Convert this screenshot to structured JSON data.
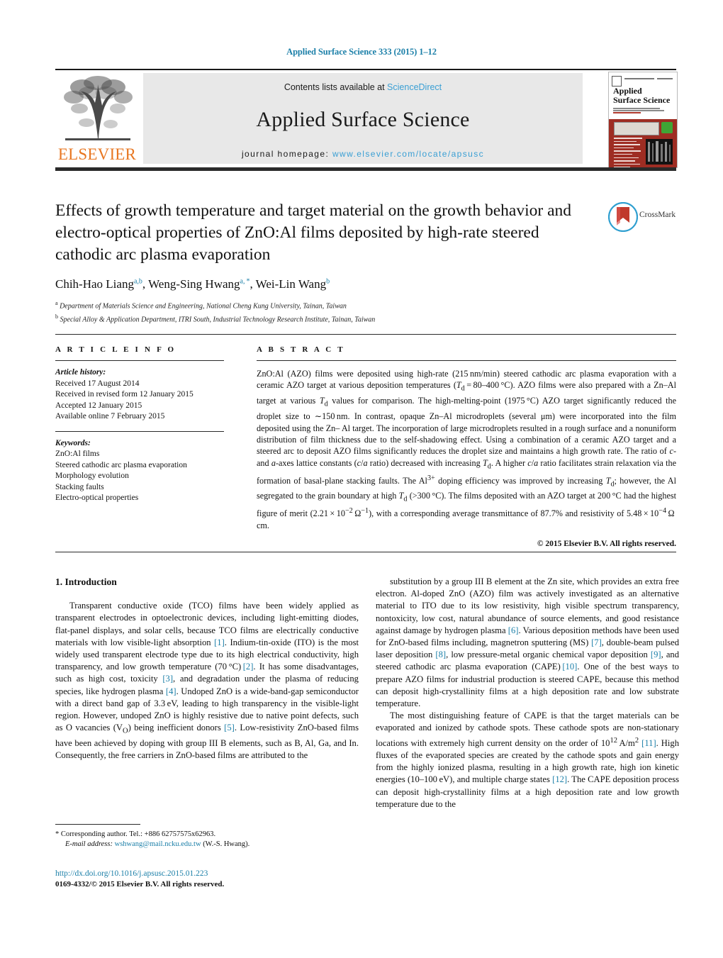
{
  "running_head": "Applied Surface Science 333 (2015) 1–12",
  "masthead": {
    "publisher_wordmark": "ELSEVIER",
    "contents_prefix": "Contents lists available at ",
    "contents_link": "ScienceDirect",
    "journal_title": "Applied Surface Science",
    "homepage_prefix": "journal homepage: ",
    "homepage_link": "www.elsevier.com/locate/apsusc",
    "cover": {
      "title_line1": "Applied",
      "title_line2": "Surface Science"
    },
    "link_color": "#3a9fd4",
    "wordmark_color": "#e87722"
  },
  "article": {
    "title": "Effects of growth temperature and target material on the growth behavior and electro-optical properties of ZnO:Al films deposited by high-rate steered cathodic arc plasma evaporation",
    "authors_html": "Chih-Hao Liang<sup>a,b</sup>, Weng-Sing Hwang<sup>a, *</sup>, Wei-Lin Wang<sup>b</sup>",
    "affiliations": [
      "Department of Materials Science and Engineering, National Cheng Kung University, Tainan, Taiwan",
      "Special Alloy & Application Department, ITRI South, Industrial Technology Research Institute, Tainan, Taiwan"
    ],
    "crossmark_label": "CrossMark"
  },
  "info": {
    "heading": "A R T I C L E   I N F O",
    "history_label": "Article history:",
    "history": [
      "Received 17 August 2014",
      "Received in revised form 12 January 2015",
      "Accepted 12 January 2015",
      "Available online 7 February 2015"
    ],
    "keywords_label": "Keywords:",
    "keywords": [
      "ZnO:Al films",
      "Steered cathodic arc plasma evaporation",
      "Morphology evolution",
      "Stacking faults",
      "Electro-optical properties"
    ]
  },
  "abstract": {
    "heading": "A B S T R A C T",
    "text_html": "ZnO:Al (AZO) films were deposited using high-rate (215 nm/min) steered cathodic arc plasma evaporation with a ceramic AZO target at various deposition temperatures (<i>T</i><sub>d</sub> = 80–400 °C). AZO films were also prepared with a Zn–Al target at various <i>T</i><sub>d</sub> values for comparison. The high-melting-point (1975 °C) AZO target significantly reduced the droplet size to ∼150 nm. In contrast, opaque Zn–Al microdroplets (several μm) were incorporated into the film deposited using the Zn– Al target. The incorporation of large microdroplets resulted in a rough surface and a nonuniform distribution of film thickness due to the self-shadowing effect. Using a combination of a ceramic AZO target and a steered arc to deposit AZO films significantly reduces the droplet size and maintains a high growth rate. The ratio of <i>c</i>- and <i>a</i>-axes lattice constants (<i>c</i>/<i>a</i> ratio) decreased with increasing <i>T</i><sub>d</sub>. A higher <i>c</i>/<i>a</i> ratio facilitates strain relaxation via the formation of basal-plane stacking faults. The Al<sup>3+</sup> doping efficiency was improved by increasing <i>T</i><sub>d</sub>; however, the Al segregated to the grain boundary at high <i>T</i><sub>d</sub> (>300 °C). The films deposited with an AZO target at 200 °C had the highest figure of merit (2.21 × 10<sup>−2</sup> Ω<sup>−1</sup>), with a corresponding average transmittance of 87.7% and resistivity of 5.48 × 10<sup>−4</sup> Ω cm.",
    "copyright": "© 2015 Elsevier B.V. All rights reserved."
  },
  "body": {
    "section_heading": "1.  Introduction",
    "left_paragraphs_html": [
      "Transparent conductive oxide (TCO) films have been widely applied as transparent electrodes in optoelectronic devices, including light-emitting diodes, flat-panel displays, and solar cells, because TCO films are electrically conductive materials with low visible-light absorption <span class=\"ref\">[1]</span>. Indium-tin-oxide (ITO) is the most widely used transparent electrode type due to its high electrical conductivity, high transparency, and low growth temperature (70 °C) <span class=\"ref\">[2]</span>. It has some disadvantages, such as high cost, toxicity <span class=\"ref\">[3]</span>, and degradation under the plasma of reducing species, like hydrogen plasma <span class=\"ref\">[4]</span>. Undoped ZnO is a wide-band-gap semiconductor with a direct band gap of 3.3 eV, leading to high transparency in the visible-light region. However, undoped ZnO is highly resistive due to native point defects, such as O vacancies (V<sub>O</sub>) being inefficient donors <span class=\"ref\">[5]</span>. Low-resistivity ZnO-based films have been achieved by doping with group III B elements, such as B, Al, Ga, and In. Consequently, the free carriers in ZnO-based films are attributed to the"
    ],
    "right_paragraphs_html": [
      "substitution by a group III B element at the Zn site, which provides an extra free electron. Al-doped ZnO (AZO) film was actively investigated as an alternative material to ITO due to its low resistivity, high visible spectrum transparency, nontoxicity, low cost, natural abundance of source elements, and good resistance against damage by hydrogen plasma <span class=\"ref\">[6]</span>. Various deposition methods have been used for ZnO-based films including, magnetron sputtering (MS) <span class=\"ref\">[7]</span>, double-beam pulsed laser deposition <span class=\"ref\">[8]</span>, low pressure-metal organic chemical vapor deposition <span class=\"ref\">[9]</span>, and steered cathodic arc plasma evaporation (CAPE) <span class=\"ref\">[10]</span>. One of the best ways to prepare AZO films for industrial production is steered CAPE, because this method can deposit high-crystallinity films at a high deposition rate and low substrate temperature.",
      "The most distinguishing feature of CAPE is that the target materials can be evaporated and ionized by cathode spots. These cathode spots are non-stationary locations with extremely high current density on the order of 10<sup>12</sup> A/m<sup>2</sup> <span class=\"ref\">[11]</span>. High fluxes of the evaporated species are created by the cathode spots and gain energy from the highly ionized plasma, resulting in a high growth rate, high ion kinetic energies (10–100 eV), and multiple charge states <span class=\"ref\">[12]</span>. The CAPE deposition process can deposit high-crystallinity films at a high deposition rate and low growth temperature due to the"
    ]
  },
  "footnote": {
    "marker": "*",
    "corresponding": "Corresponding author. Tel.: +886 62757575x62963.",
    "email_label": "E-mail address:",
    "email": "wshwang@mail.ncku.edu.tw",
    "email_suffix": "(W.-S. Hwang)."
  },
  "footer": {
    "doi": "http://dx.doi.org/10.1016/j.apsusc.2015.01.223",
    "issn_line": "0169-4332/© 2015 Elsevier B.V. All rights reserved."
  }
}
